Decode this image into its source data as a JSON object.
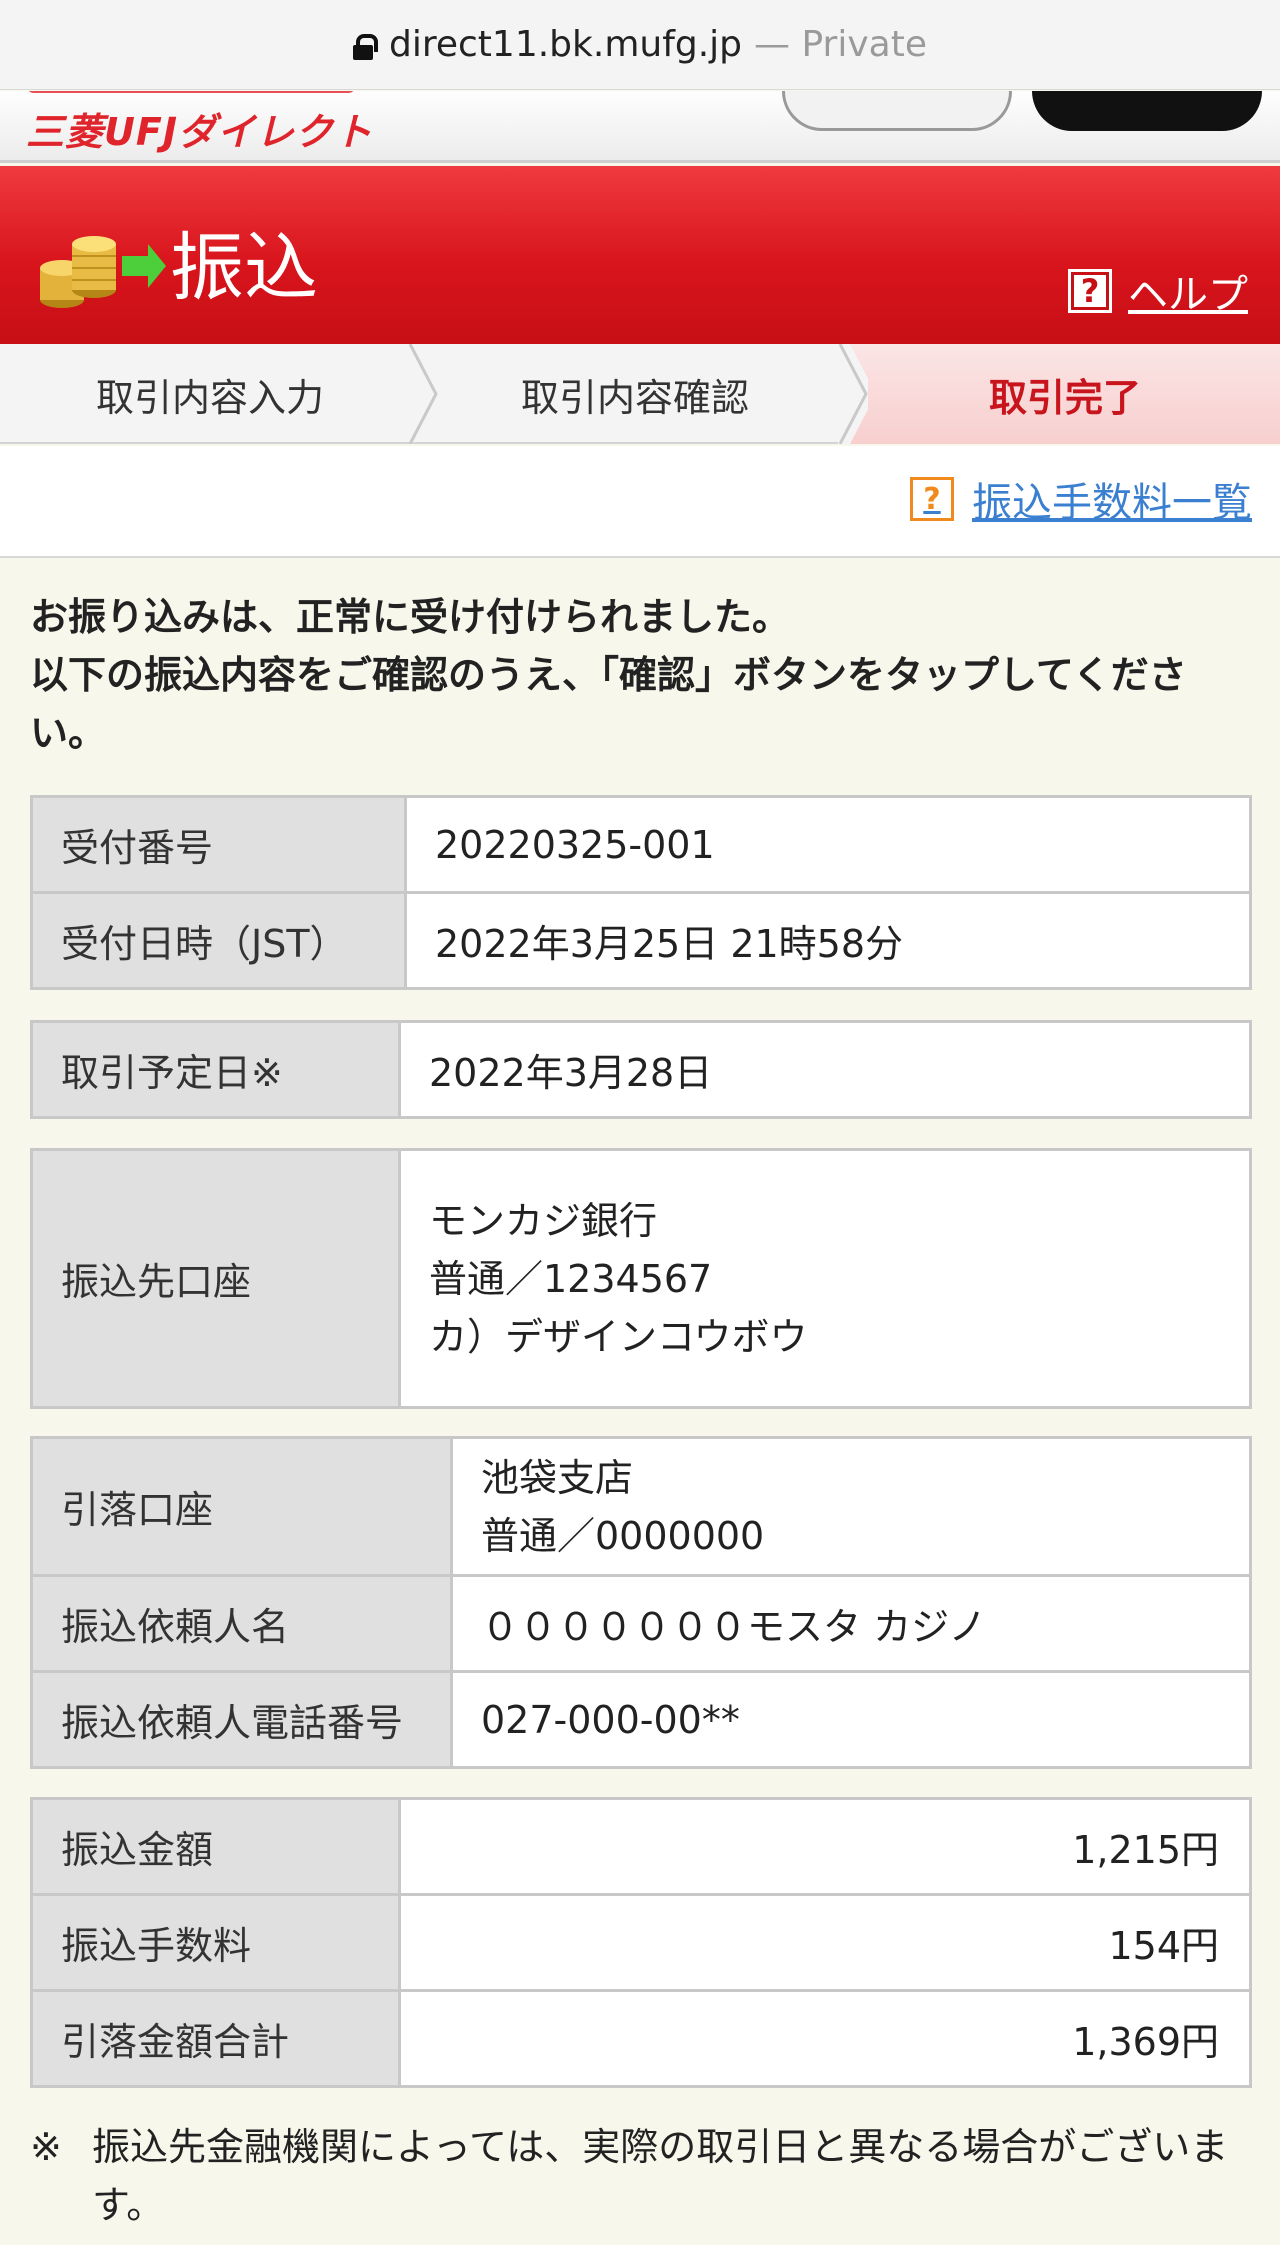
{
  "browser": {
    "url": "direct11.bk.mufg.jp",
    "private_label": "— Private"
  },
  "header": {
    "logo": "三菱UFJダイレクト"
  },
  "title_band": {
    "title": "振込",
    "help": "ヘルプ",
    "help_icon": "?"
  },
  "steps": [
    "取引内容入力",
    "取引内容確認",
    "取引完了"
  ],
  "fee_link": {
    "label": "振込手数料一覧",
    "icon": "?"
  },
  "message": {
    "line1": "お振り込みは、正常に受け付けられました。",
    "line2": "以下の振込内容をご確認のうえ、「確認」ボタンをタップしてください。"
  },
  "receipt": [
    {
      "label": "受付番号",
      "value": "20220325-001"
    },
    {
      "label": "受付日時（JST）",
      "value": "2022年3月25日 21時58分"
    }
  ],
  "schedule": {
    "label": "取引予定日※",
    "value": "2022年3月28日"
  },
  "payee": {
    "label": "振込先口座",
    "bank": "モンカジ銀行",
    "account": "普通／1234567",
    "name": "カ）デザインコウボウ"
  },
  "debit": {
    "account_label": "引落口座",
    "branch": "池袋支店",
    "account": "普通／0000000",
    "requester_label": "振込依頼人名",
    "requester": "０００００００モスタ カジノ",
    "phone_label": "振込依頼人電話番号",
    "phone": "027-000-00**"
  },
  "amounts": [
    {
      "label": "振込金額",
      "value": "1,215円"
    },
    {
      "label": "振込手数料",
      "value": "154円"
    },
    {
      "label": "引落金額合計",
      "value": "1,369円"
    }
  ],
  "note": {
    "mark": "※",
    "text": "振込先金融機関によっては、実際の取引日と異なる場合がございます。"
  },
  "colors": {
    "brand_red": "#d8141c",
    "link_blue": "#3b7fd0",
    "help_orange": "#f08a1c",
    "page_bg": "#f7f7ec"
  }
}
